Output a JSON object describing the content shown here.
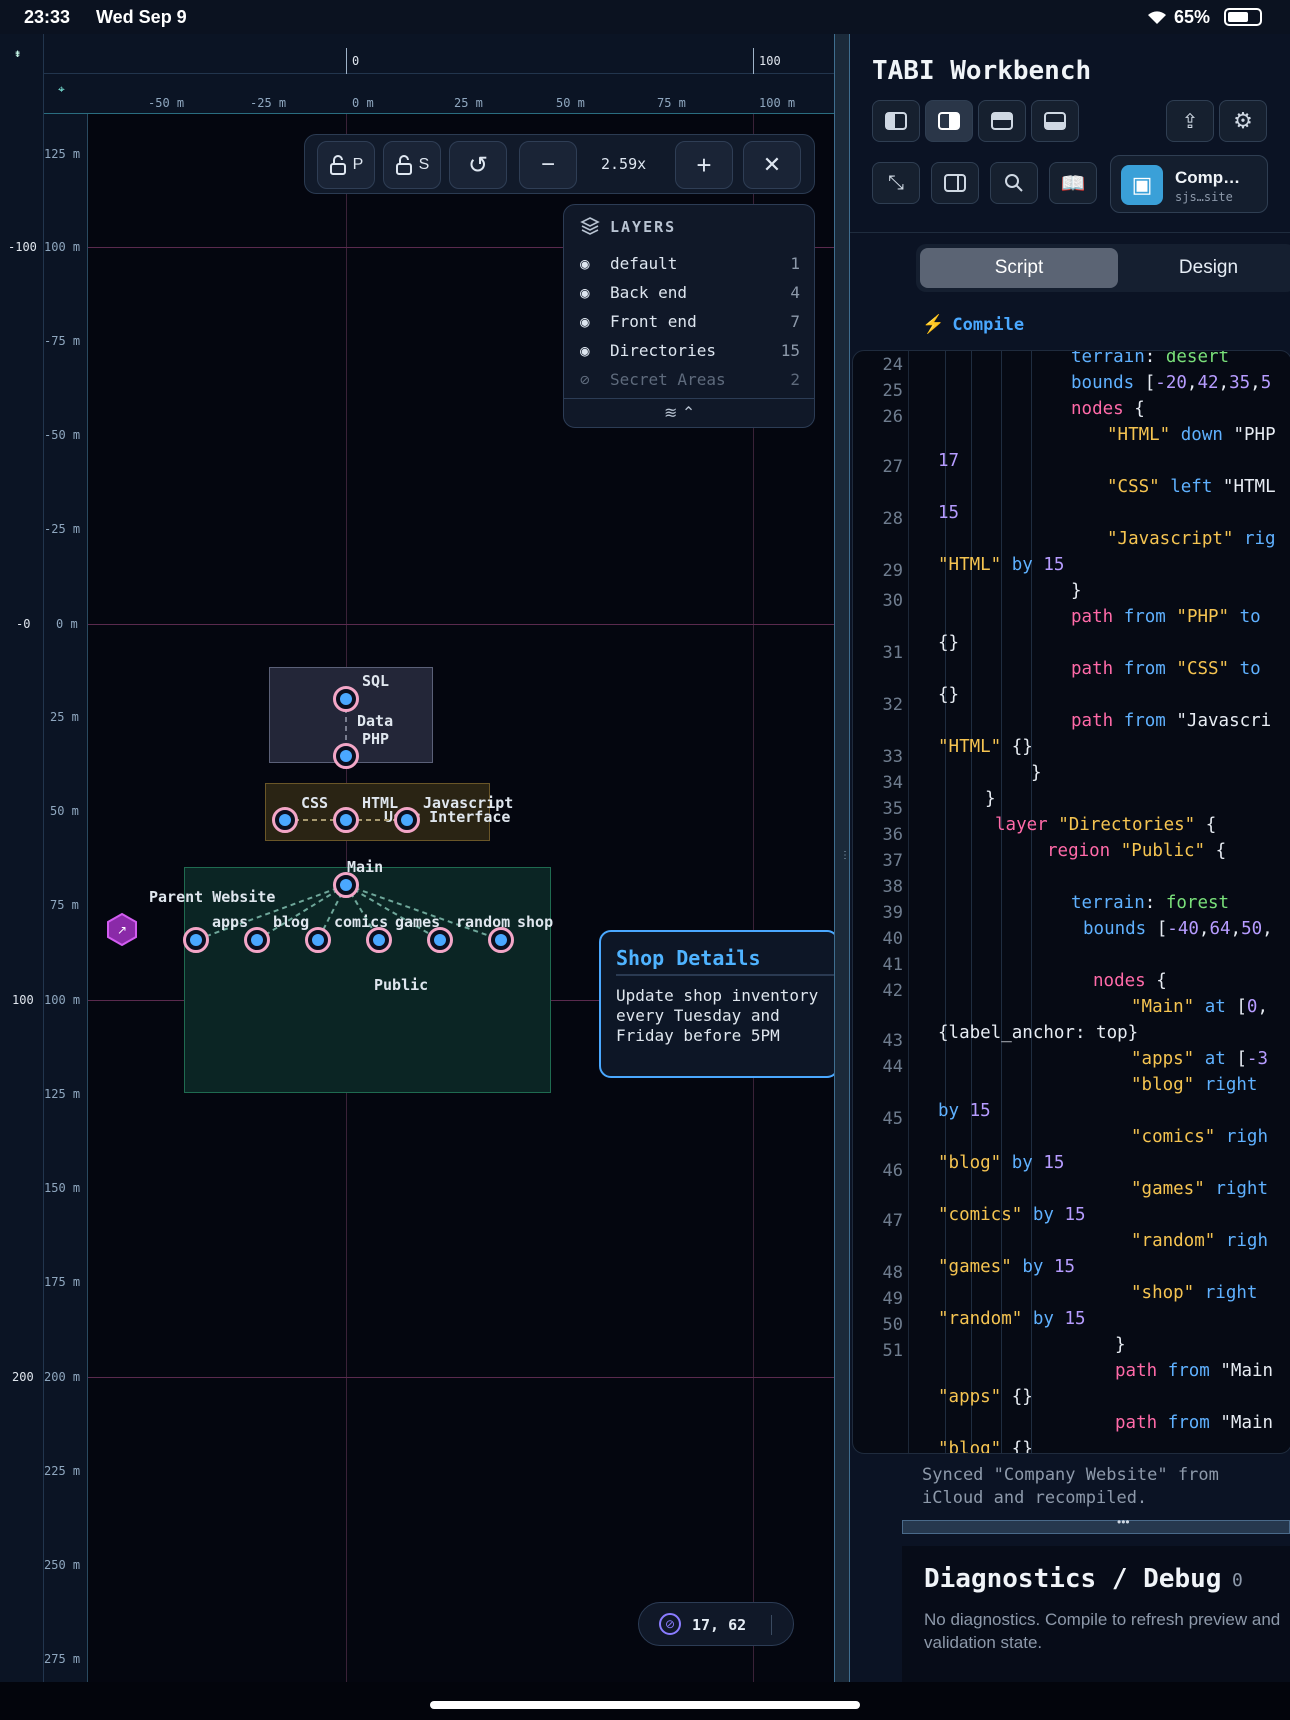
{
  "status_bar": {
    "time": "23:33",
    "date": "Wed Sep 9",
    "battery": "65%"
  },
  "rulers": {
    "top_primary": [
      "0",
      "100"
    ],
    "top_secondary": [
      "-50 m",
      "-25 m",
      "0 m",
      "25 m",
      "50 m",
      "75 m",
      "100 m"
    ],
    "left_primary": [
      "-100",
      "-0",
      "100",
      "200"
    ],
    "left_secondary": [
      "125 m",
      "100 m",
      "-75 m",
      "-50 m",
      "-25 m",
      "0 m",
      "25 m",
      "50 m",
      "75 m",
      "100 m",
      "125 m",
      "150 m",
      "175 m",
      "200 m",
      "225 m",
      "250 m",
      "275 m"
    ]
  },
  "toolbar": {
    "lock_p": "P",
    "lock_s": "S",
    "zoom": "2.59x"
  },
  "layers": {
    "title": "LAYERS",
    "items": [
      {
        "name": "default",
        "count": "1"
      },
      {
        "name": "Back end",
        "count": "4"
      },
      {
        "name": "Front end",
        "count": "7"
      },
      {
        "name": "Directories",
        "count": "15"
      },
      {
        "name": "Secret Areas",
        "count": "2"
      }
    ]
  },
  "canvas": {
    "region_data": "Data",
    "region_ui": "User Interface",
    "region_public": "Public",
    "parent_label": "Parent Website",
    "nodes": {
      "sql": "SQL",
      "php": "PHP",
      "css": "CSS",
      "html": "HTML",
      "javascript": "Javascript",
      "main": "Main",
      "apps": "apps",
      "blog": "blog",
      "comics": "comics",
      "games": "games",
      "random": "random",
      "shop": "shop"
    },
    "coords": "17, 62"
  },
  "popup": {
    "title": "Shop Details",
    "body": "Update shop inventory every Tuesday and Friday before 5PM"
  },
  "sidebar": {
    "title": "TABI Workbench",
    "doc_title": "Comp…",
    "doc_sub": "sjs…site",
    "tabs": [
      "Script",
      "Design"
    ],
    "compile": "Compile",
    "status_msg": "Synced \"Company Website\" from iCloud and recompiled.",
    "diag_title": "Diagnostics / Debug",
    "diag_count": "0",
    "diag_text": "No diagnostics. Compile to refresh preview and validation state."
  },
  "code": {
    "line_numbers": [
      "24",
      "25",
      "26",
      "27",
      "28",
      "29",
      "30",
      "31",
      "32",
      "33",
      "34",
      "35",
      "36",
      "37",
      "38",
      "39",
      "40",
      "41",
      "42",
      "43",
      "44",
      "45",
      "46",
      "47",
      "48",
      "49",
      "50",
      "51"
    ],
    "lines": [
      "terrain: desert",
      "bounds [-20,42,35,5",
      "nodes {",
      "\"HTML\" down \"PHP",
      "17",
      "\"CSS\" left \"HTML",
      "15",
      "\"Javascript\" rig",
      "\"HTML\" by 15",
      "}",
      "path from \"PHP\" to",
      "{}",
      "path from \"CSS\" to",
      "{}",
      "path from \"Javascri",
      "\"HTML\" {}",
      "}",
      "}",
      "layer \"Directories\" {",
      "region \"Public\" {",
      "terrain: forest",
      "bounds [-40,64,50,",
      "nodes {",
      "\"Main\" at [0,",
      "{label_anchor: top}",
      "\"apps\" at [-3",
      "\"blog\" right",
      "by 15",
      "\"comics\" righ",
      "\"blog\" by 15",
      "\"games\" right",
      "\"comics\" by 15",
      "\"random\" righ",
      "\"games\" by 15",
      "\"shop\" right",
      "\"random\" by 15",
      "}",
      "path from \"Main",
      "\"apps\" {}",
      "path from \"Main",
      "\"blog\" {}"
    ]
  }
}
